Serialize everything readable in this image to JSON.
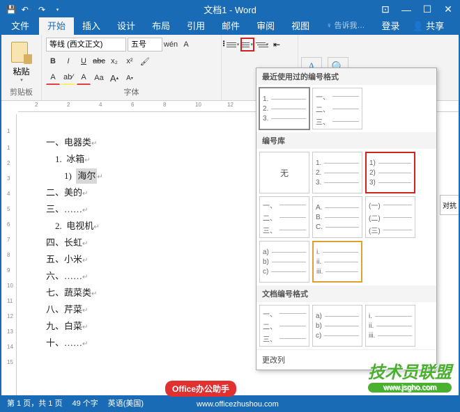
{
  "titlebar": {
    "title": "文档1 - Word",
    "save": "保存",
    "undo": "撤销",
    "redo": "重做"
  },
  "tabs": {
    "file": "文件",
    "home": "开始",
    "insert": "插入",
    "design": "设计",
    "layout": "布局",
    "references": "引用",
    "mail": "邮件",
    "review": "审阅",
    "view": "视图",
    "tell": "告诉我…",
    "login": "登录",
    "share": "共享"
  },
  "ribbon": {
    "paste_label": "粘贴",
    "clipboard_label": "剪贴板",
    "font_label": "字体",
    "font_name": "等线 (西文正文)",
    "font_size": "五号",
    "bold": "B",
    "italic": "I",
    "underline": "U",
    "strike": "abc",
    "sub": "x₂",
    "sup": "x²",
    "wen": "wén",
    "grow": "A",
    "shrink": "A",
    "clear": "A",
    "aa": "Aa",
    "highlight": "ab⁄",
    "font_color": "A"
  },
  "doc": {
    "lines": [
      "一、电器类",
      "    1.  冰箱",
      "        1)  海尔",
      "二、美的",
      "三、……",
      "    2.  电视机",
      "四、长虹",
      "五、小米",
      "六、……",
      "七、蔬菜类",
      "八、芹菜",
      "九、白菜",
      "十、……"
    ],
    "highlighted_line_index": 2,
    "highlighted_part": "海尔"
  },
  "num_panel": {
    "section_recent": "最近使用过的编号格式",
    "section_library": "编号库",
    "section_doc": "文档编号格式",
    "footer_change": "更改列",
    "none_label": "无",
    "library_items": [
      {
        "key": "none",
        "labels": []
      },
      {
        "key": "num-dot",
        "labels": [
          "1.",
          "2.",
          "3."
        ]
      },
      {
        "key": "num-paren",
        "labels": [
          "1)",
          "2)",
          "3)"
        ],
        "red": true
      },
      {
        "key": "cn-caesura",
        "labels": [
          "一、",
          "二、",
          "三、"
        ]
      },
      {
        "key": "abc-upper",
        "labels": [
          "A.",
          "B.",
          "C."
        ]
      },
      {
        "key": "cn-paren",
        "labels": [
          "(一)",
          "(二)",
          "(三)"
        ]
      },
      {
        "key": "abc-paren",
        "labels": [
          "a)",
          "b)",
          "c)"
        ]
      },
      {
        "key": "roman-lower",
        "labels": [
          "i.",
          "ii.",
          "iii."
        ],
        "selected": true
      }
    ],
    "recent_items": [
      {
        "key": "num-dot",
        "labels": [
          "1.",
          "2.",
          "3."
        ],
        "thick": true
      },
      {
        "key": "cn-caesura",
        "labels": [
          "一、",
          "二、",
          "三、"
        ]
      }
    ],
    "doc_items": [
      {
        "key": "cn-caesura",
        "labels": [
          "一、",
          "二、",
          "三、"
        ]
      },
      {
        "key": "abc-paren",
        "labels": [
          "a)",
          "b)",
          "c)"
        ]
      },
      {
        "key": "roman-lower",
        "labels": [
          "i.",
          "ii.",
          "iii."
        ]
      }
    ]
  },
  "side_tab": "对抗",
  "status": {
    "page": "第 1 页，共 1 页",
    "words": "49 个字",
    "lang": "英语(美国)"
  },
  "watermarks": {
    "wm1": "Office办公助手",
    "wm2": "技术员联盟",
    "url1": "www.officezhushou.com",
    "url2": "www.jsgho.com"
  }
}
